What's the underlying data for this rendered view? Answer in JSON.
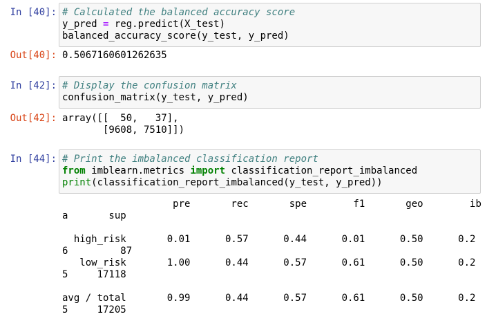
{
  "cells": [
    {
      "in_prompt": "In [40]:",
      "comment": "# Calculated the balanced accuracy score",
      "line2_lhs": "y_pred ",
      "line2_op": "=",
      "line2_rhs": " reg.predict(X_test)",
      "line3": "balanced_accuracy_score(y_test, y_pred)",
      "out_prompt": "Out[40]:",
      "output": [
        "0.5067160601262635"
      ]
    },
    {
      "in_prompt": "In [42]:",
      "comment": "# Display the confusion matrix",
      "line2": "confusion_matrix(y_test, y_pred)",
      "out_prompt": "Out[42]:",
      "output": [
        "array([[  50,   37],",
        "       [9608, 7510]])"
      ]
    },
    {
      "in_prompt": "In [44]:",
      "comment": "# Print the imbalanced classification report",
      "kw_from": "from",
      "module": " imblearn.metrics ",
      "kw_import": "import",
      "imported": " classification_report_imbalanced",
      "builtin_print": "print",
      "print_args": "(classification_report_imbalanced(y_test, y_pred))",
      "output": [
        "                   pre       rec       spe        f1       geo        ib",
        "a       sup",
        "",
        "  high_risk       0.01      0.57      0.44      0.01      0.50      0.2",
        "6         87",
        "   low_risk       1.00      0.44      0.57      0.61      0.50      0.2",
        "5     17118",
        "",
        "avg / total       0.99      0.44      0.57      0.61      0.50      0.2",
        "5     17205"
      ]
    }
  ]
}
